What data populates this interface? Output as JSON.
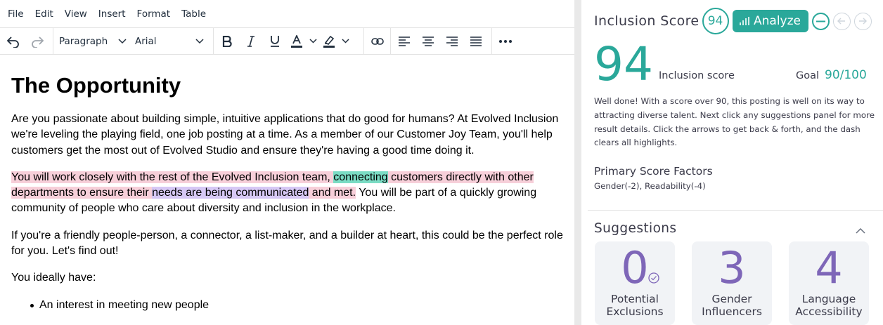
{
  "menu": [
    "File",
    "Edit",
    "View",
    "Insert",
    "Format",
    "Table"
  ],
  "toolbar": {
    "block_format": "Paragraph",
    "font_family": "Arial"
  },
  "document": {
    "heading": "The Opportunity",
    "p1": "Are you passionate about building simple, intuitive applications that do good for humans? At Evolved Inclusion we're leveling the playing field, one job posting at a time. As a member of our Customer Joy Team, you'll help customers get the most out of Evolved Studio and ensure they're having a good time doing it.",
    "p2": {
      "seg1": "You will work closely with the rest of the Evolved Inclusion team, ",
      "seg2": "connecting",
      "seg3": " customers directly with other departments to ensure their ",
      "seg4": "needs are being communicated",
      "seg5": " and met.",
      "seg6": " You will be part of a quickly growing community of people who care about diversity and inclusion in the workplace."
    },
    "p3": "If you're a friendly people-person, a connector, a list-maker, and a builder at heart, this could be the perfect role for you. Let's find out!",
    "p4": "You ideally have:",
    "list": [
      "An interest in meeting new people"
    ]
  },
  "panel": {
    "title": "Inclusion Score",
    "score_badge": "94",
    "analyze_label": "Analyze",
    "big_score": "94",
    "score_label": "Inclusion score",
    "goal_label": "Goal",
    "goal_value": "90/100",
    "description": "Well done! With a score over 90, this posting is well on its way to attracting diverse talent. Next click any suggestions panel for more result details. Click the arrows to get back & forth, and the dash clears all highlights.",
    "factors_title": "Primary Score Factors",
    "factors": "Gender(-2),  Readability(-4)",
    "suggestions_title": "Suggestions",
    "cards": [
      {
        "count": "0",
        "label_line1": "Potential",
        "label_line2": "Exclusions"
      },
      {
        "count": "3",
        "label_line1": "Gender",
        "label_line2": "Influencers"
      },
      {
        "count": "4",
        "label_line1": "Language",
        "label_line2": "Accessibility"
      }
    ]
  },
  "colors": {
    "accent": "#2aa89a",
    "suggestion_number": "#7e66b8",
    "highlight_pink": "#f7cfd9",
    "highlight_teal": "#7bdcc4",
    "highlight_lavender": "#d6c8f5"
  }
}
